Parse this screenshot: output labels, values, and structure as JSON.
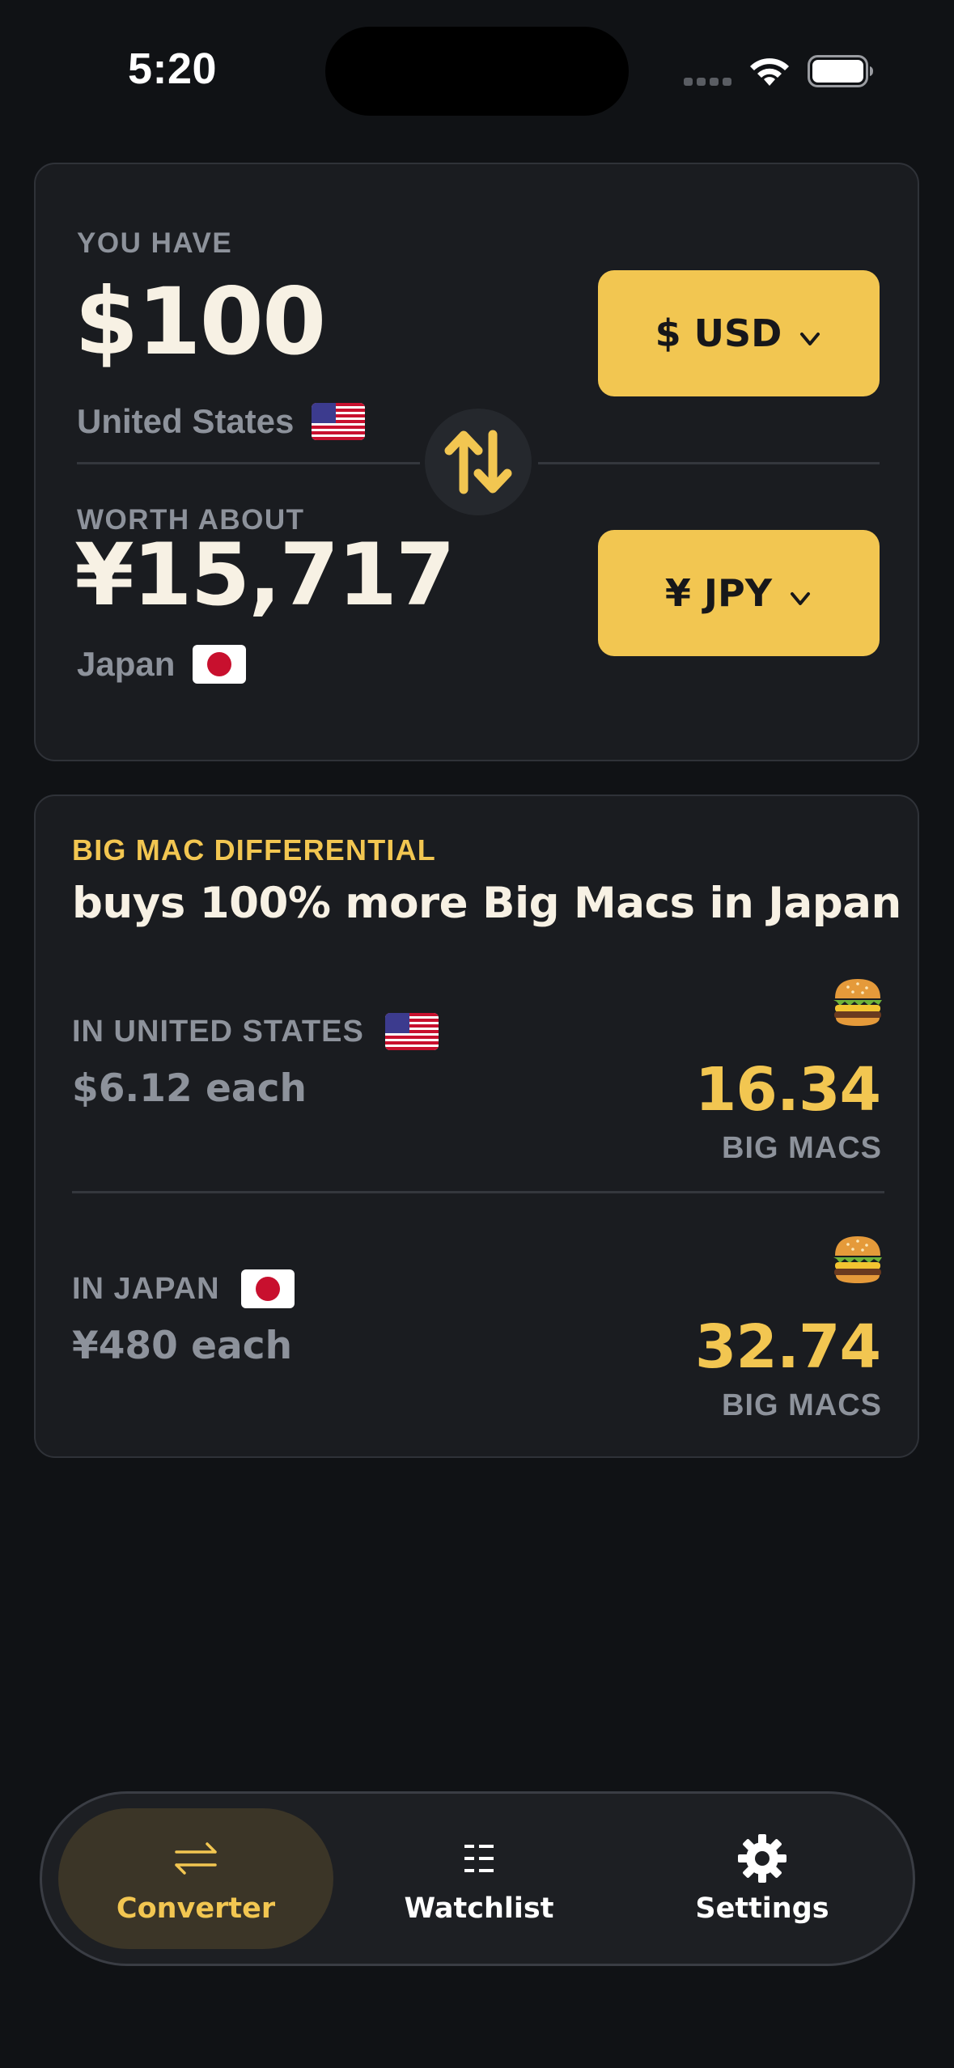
{
  "status_bar": {
    "time": "5:20"
  },
  "converter": {
    "from": {
      "label": "YOU HAVE",
      "amount": "$100",
      "country": "United States",
      "currency_button": "$ USD"
    },
    "to": {
      "label": "WORTH ABOUT",
      "amount": "¥15,717",
      "country": "Japan",
      "currency_button": "¥ JPY"
    }
  },
  "big_mac": {
    "kicker": "BIG MAC DIFFERENTIAL",
    "headline": "buys 100% more Big Macs in Japan",
    "regions": [
      {
        "label": "IN UNITED STATES",
        "price": "$6.12 each",
        "count": "16.34",
        "unit": "BIG MACS"
      },
      {
        "label": "IN JAPAN",
        "price": "¥480 each",
        "count": "32.74",
        "unit": "BIG MACS"
      }
    ]
  },
  "tab_bar": {
    "tabs": [
      {
        "label": "Converter",
        "icon": "swap-arrows-icon",
        "active": true
      },
      {
        "label": "Watchlist",
        "icon": "list-icon",
        "active": false
      },
      {
        "label": "Settings",
        "icon": "gear-icon",
        "active": false
      }
    ]
  },
  "colors": {
    "background": "#101215",
    "card": "#1a1c20",
    "accent": "#f2c651",
    "muted_text": "#8d929b",
    "primary_text": "#f7f1e4"
  }
}
